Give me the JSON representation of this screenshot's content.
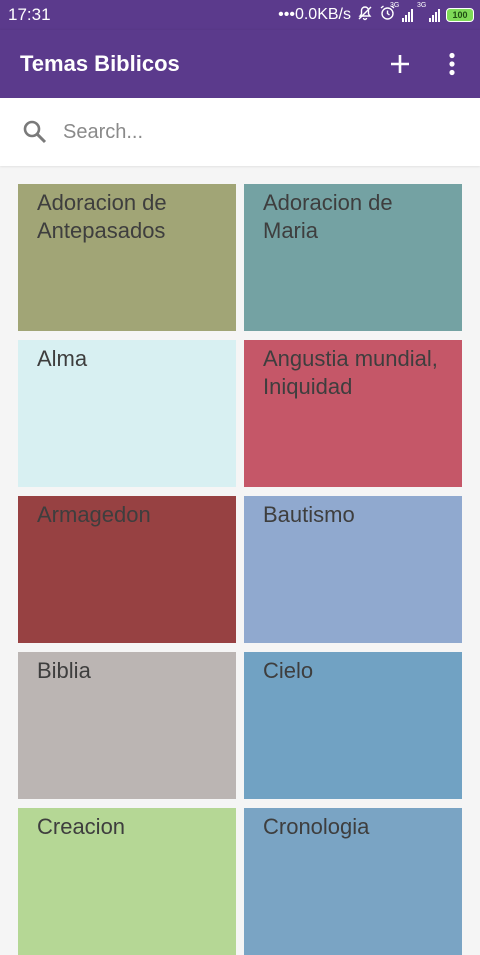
{
  "status_bar": {
    "time": "17:31",
    "net_speed": "•••0.0KB/s",
    "network_labels": [
      "3G",
      "3G"
    ],
    "battery": "100",
    "icons": [
      "mute-icon",
      "alarm-icon",
      "signal-icon",
      "signal-icon",
      "battery-icon"
    ]
  },
  "app_bar": {
    "title": "Temas Biblicos",
    "actions": [
      "add-icon",
      "more-vert-icon"
    ],
    "color": "#5b3a8c"
  },
  "search": {
    "placeholder": "Search...",
    "value": ""
  },
  "topics": [
    {
      "label": "Adoracion de Antepasados",
      "color": "#a1a576"
    },
    {
      "label": "Adoracion de Maria",
      "color": "#74a2a3"
    },
    {
      "label": "Alma",
      "color": "#d8f0f2"
    },
    {
      "label": "Angustia mundial, Iniquidad",
      "color": "#c55768"
    },
    {
      "label": "Armagedon",
      "color": "#974142"
    },
    {
      "label": "Bautismo",
      "color": "#90a9cf"
    },
    {
      "label": "Biblia",
      "color": "#bbb5b3"
    },
    {
      "label": "Cielo",
      "color": "#71a2c3"
    },
    {
      "label": "Creacion",
      "color": "#b5d795"
    },
    {
      "label": "Cronologia",
      "color": "#7aa4c4"
    }
  ]
}
